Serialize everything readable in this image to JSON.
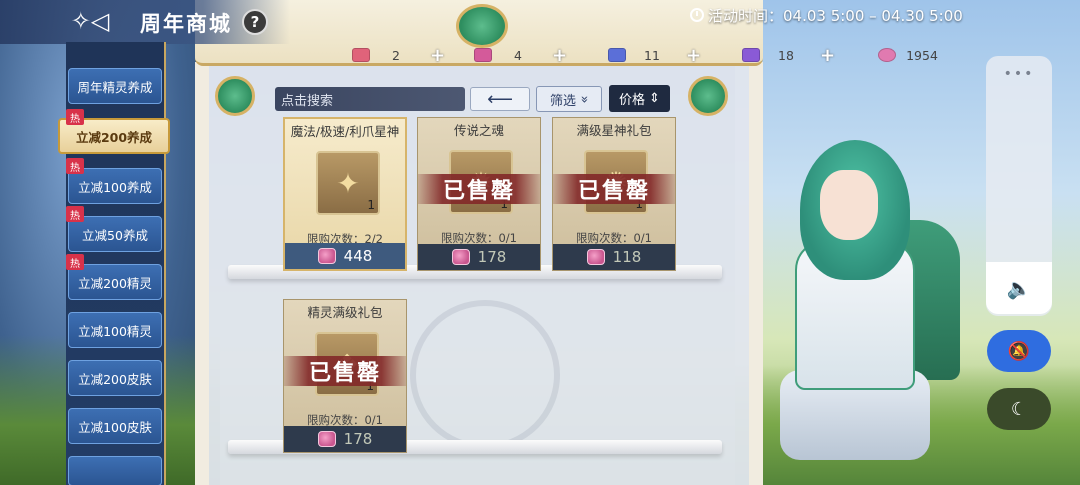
{
  "header": {
    "title": "周年商城",
    "help_label": "?",
    "back_icon": "back-ornament-icon"
  },
  "event": {
    "label": "活动时间：04.03 5:00 – 04.30 5:00"
  },
  "currencies": [
    {
      "icon": "ticket-red-icon",
      "color": "#e0637a",
      "value": "2"
    },
    {
      "icon": "ticket-pink-icon",
      "color": "#d45a9a",
      "value": "4"
    },
    {
      "icon": "ticket-blue-icon",
      "color": "#5b6fd8",
      "value": "11"
    },
    {
      "icon": "ticket-purple-icon",
      "color": "#8a5ad6",
      "value": "18"
    },
    {
      "icon": "gem-icon",
      "color": "#e07ab0",
      "value": "1954"
    }
  ],
  "sidebar": {
    "items": [
      {
        "label": "周年精灵养成",
        "hot": false,
        "active": false
      },
      {
        "label": "立减200养成",
        "hot": true,
        "active": true
      },
      {
        "label": "立减100养成",
        "hot": true,
        "active": false
      },
      {
        "label": "立减50养成",
        "hot": true,
        "active": false
      },
      {
        "label": "立减200精灵",
        "hot": true,
        "active": false
      },
      {
        "label": "立减100精灵",
        "hot": false,
        "active": false
      },
      {
        "label": "立减200皮肤",
        "hot": false,
        "active": false
      },
      {
        "label": "立减100皮肤",
        "hot": false,
        "active": false
      }
    ],
    "hot_label": "热"
  },
  "search": {
    "placeholder": "点击搜索",
    "back_arrow": "⟵",
    "filter_label": "筛选",
    "filter_icon": "»",
    "price_label": "价格",
    "price_icon": "⇕"
  },
  "products": [
    {
      "title": "魔法/极速/利爪星神",
      "qty": "1",
      "limit": "限购次数：2/2",
      "price": "448",
      "sold_out": false,
      "featured": true,
      "glyph": "✦"
    },
    {
      "title": "传说之魂",
      "qty": "1",
      "limit": "限购次数：0/1",
      "price": "178",
      "sold_out": true,
      "featured": false,
      "glyph": "✹"
    },
    {
      "title": "满级星神礼包",
      "qty": "1",
      "limit": "限购次数：0/1",
      "price": "118",
      "sold_out": true,
      "featured": false,
      "glyph": "✺"
    },
    {
      "title": "精灵满级礼包",
      "qty": "1",
      "limit": "限购次数：0/1",
      "price": "178",
      "sold_out": true,
      "featured": false,
      "glyph": "❖"
    }
  ],
  "sold_out_label": "已售罄",
  "controls": {
    "dots": "•••",
    "volume_icon": "🔈",
    "mute_icon": "🔕",
    "night_icon": "☾"
  }
}
